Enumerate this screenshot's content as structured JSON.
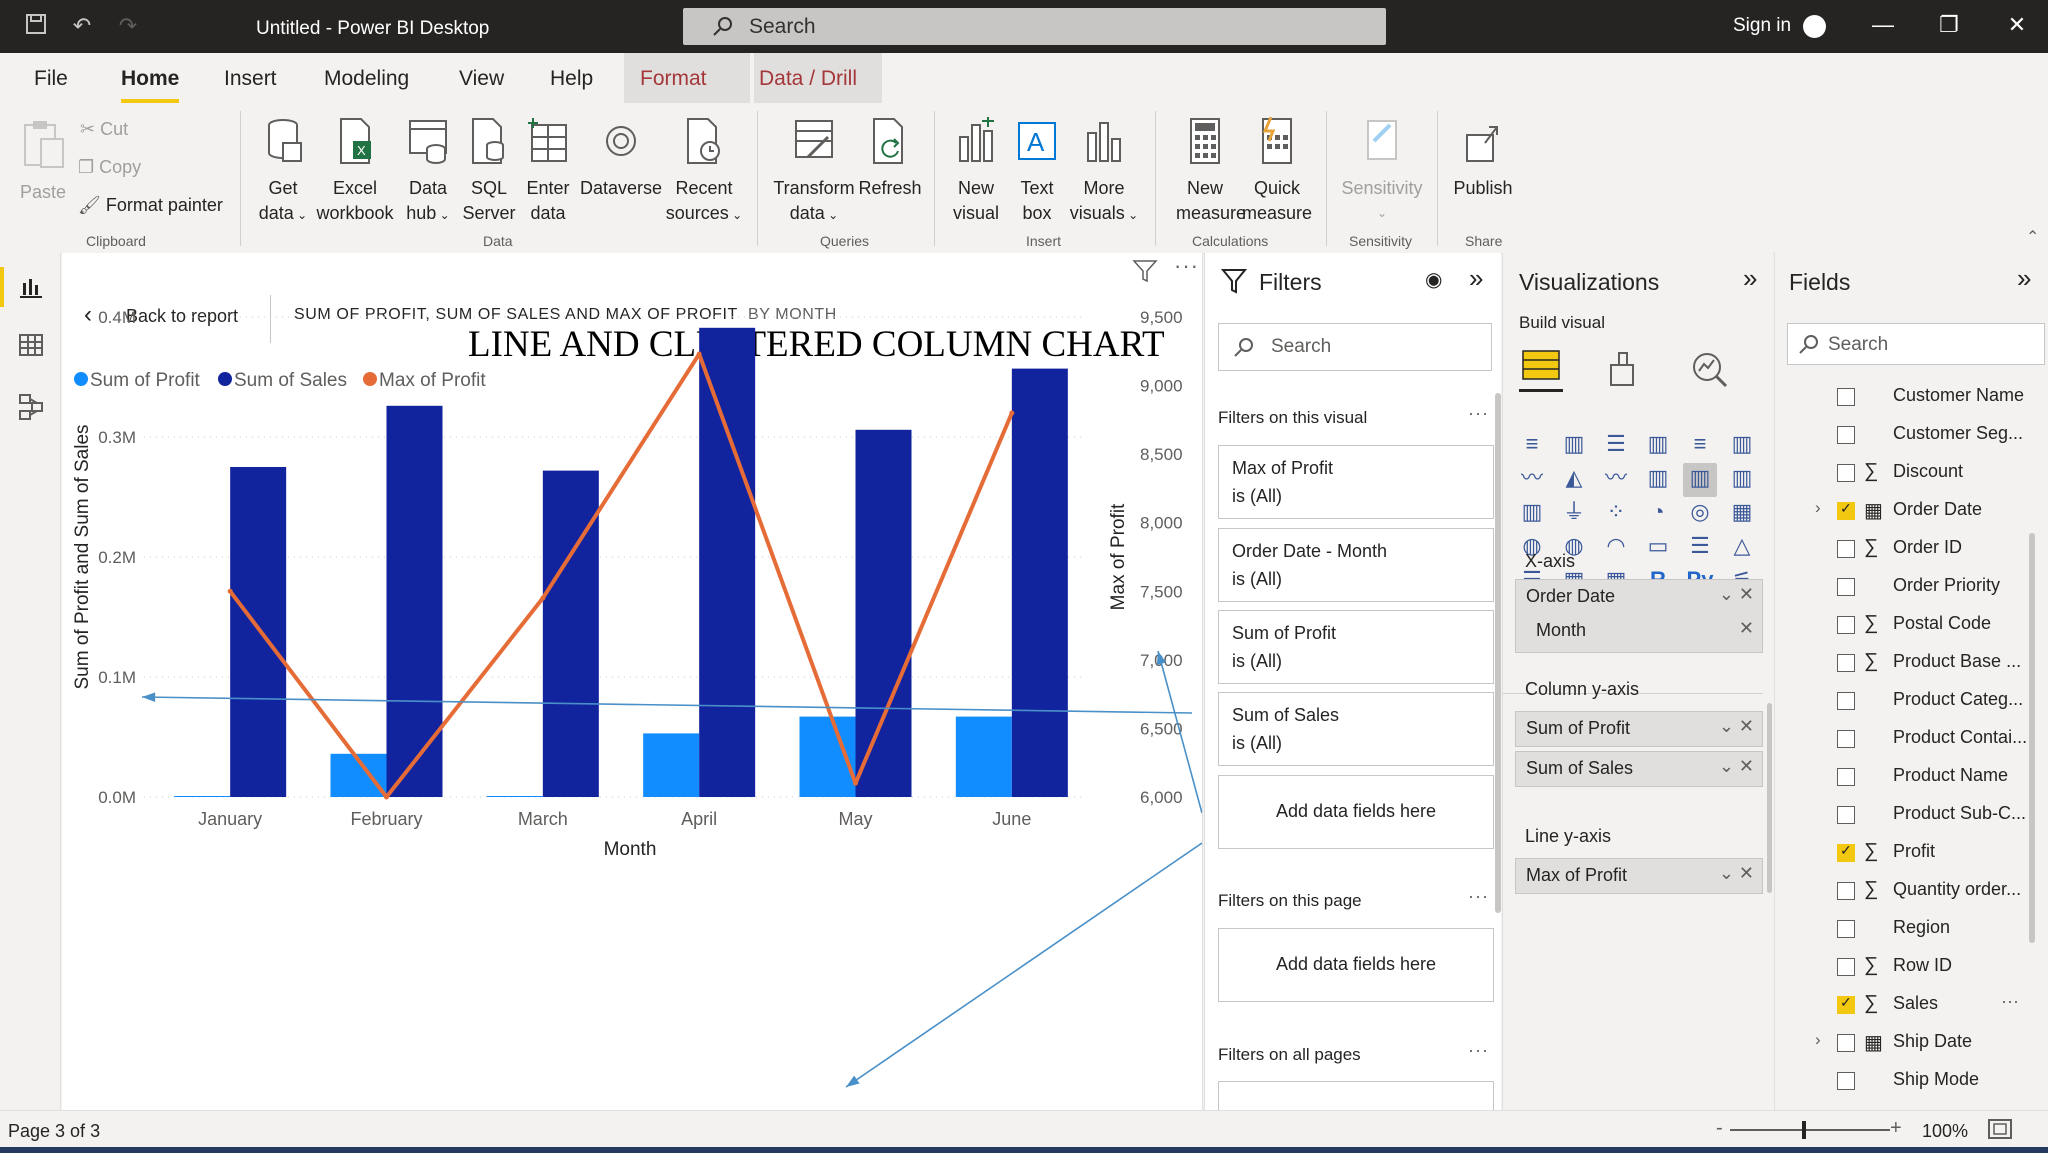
{
  "app": {
    "title": "Untitled - Power BI Desktop",
    "search_label": "Search",
    "sign_in": "Sign in"
  },
  "tabs": [
    "File",
    "Home",
    "Insert",
    "Modeling",
    "View",
    "Help",
    "Format",
    "Data / Drill"
  ],
  "ribbon": {
    "paste": "Paste",
    "cut": "Cut",
    "copy": "Copy",
    "format_painter": "Format painter",
    "clipboard": "Clipboard",
    "get_data": [
      "Get",
      "data"
    ],
    "excel": [
      "Excel",
      "workbook"
    ],
    "data_hub": [
      "Data",
      "hub"
    ],
    "sql": [
      "SQL",
      "Server"
    ],
    "enter_data": [
      "Enter",
      "data"
    ],
    "dataverse": "Dataverse",
    "recent": [
      "Recent",
      "sources"
    ],
    "data_group": "Data",
    "transform": [
      "Transform",
      "data"
    ],
    "refresh": "Refresh",
    "queries": "Queries",
    "new_visual": [
      "New",
      "visual"
    ],
    "text_box": [
      "Text",
      "box"
    ],
    "more_visuals": [
      "More",
      "visuals"
    ],
    "insert": "Insert",
    "new_measure": [
      "New",
      "measure"
    ],
    "quick_measure": [
      "Quick",
      "measure"
    ],
    "calculations": "Calculations",
    "sensitivity": "Sensitivity",
    "sensitivity_group": "Sensitivity",
    "publish": "Publish",
    "share": "Share"
  },
  "canvas": {
    "back": "Back to report",
    "header_title": "SUM OF PROFIT, SUM OF SALES AND MAX OF PROFIT",
    "header_by": "BY MONTH",
    "chart_caption": "LINE AND CLUSTERED COLUMN CHART"
  },
  "chart_data": {
    "type": "bar",
    "categories": [
      "January",
      "February",
      "March",
      "April",
      "May",
      "June"
    ],
    "xlabel": "Month",
    "ylabel": "Sum of Profit and Sum of Sales",
    "y2label": "Max of Profit",
    "legend_position": "top-left",
    "grid": true,
    "ylim": [
      0,
      400000
    ],
    "yticks": [
      "0.0M",
      "0.1M",
      "0.2M",
      "0.3M",
      "0.4M"
    ],
    "y2lim": [
      6000,
      9500
    ],
    "y2ticks": [
      "6,000",
      "6,500",
      "7,000",
      "7,500",
      "8,000",
      "8,500",
      "9,000",
      "9,500"
    ],
    "series": [
      {
        "name": "Sum of Profit",
        "kind": "column",
        "color": "#118dff",
        "values": [
          0,
          36000,
          0,
          53000,
          67000,
          67000
        ]
      },
      {
        "name": "Sum of Sales",
        "kind": "column",
        "color": "#12239e",
        "values": [
          275000,
          326000,
          272000,
          391000,
          306000,
          357000
        ]
      },
      {
        "name": "Max of Profit",
        "kind": "line",
        "axis": "secondary",
        "color": "#e66c37",
        "values": [
          7500,
          6000,
          7450,
          9230,
          6100,
          8800
        ]
      }
    ]
  },
  "filters": {
    "title": "Filters",
    "search": "Search",
    "on_visual": "Filters on this visual",
    "cards": [
      {
        "name": "Max of Profit",
        "state": "is (All)"
      },
      {
        "name": "Order Date - Month",
        "state": "is (All)"
      },
      {
        "name": "Sum of Profit",
        "state": "is (All)"
      },
      {
        "name": "Sum of Sales",
        "state": "is (All)"
      }
    ],
    "add_here": "Add data fields here",
    "on_page": "Filters on this page",
    "add_here_page": "Add data fields here",
    "on_all": "Filters on all pages"
  },
  "viz": {
    "title": "Visualizations",
    "build": "Build visual",
    "x_axis": "X-axis",
    "x_field": "Order Date",
    "x_sub": "Month",
    "col_axis": "Column y-axis",
    "col_fields": [
      "Sum of Profit",
      "Sum of Sales"
    ],
    "line_axis": "Line y-axis",
    "line_field": "Max of Profit"
  },
  "fields": {
    "title": "Fields",
    "search": "Search",
    "items": [
      {
        "name": "Customer Name",
        "sigma": false,
        "checked": false
      },
      {
        "name": "Customer Seg...",
        "sigma": false,
        "checked": false
      },
      {
        "name": "Discount",
        "sigma": true,
        "checked": false
      },
      {
        "name": "Order Date",
        "sigma": false,
        "checked": true
      },
      {
        "name": "Order ID",
        "sigma": true,
        "checked": false
      },
      {
        "name": "Order Priority",
        "sigma": false,
        "checked": false
      },
      {
        "name": "Postal Code",
        "sigma": true,
        "checked": false
      },
      {
        "name": "Product Base ...",
        "sigma": true,
        "checked": false
      },
      {
        "name": "Product Categ...",
        "sigma": false,
        "checked": false
      },
      {
        "name": "Product Contai...",
        "sigma": false,
        "checked": false
      },
      {
        "name": "Product Name",
        "sigma": false,
        "checked": false
      },
      {
        "name": "Product Sub-C...",
        "sigma": false,
        "checked": false
      },
      {
        "name": "Profit",
        "sigma": true,
        "checked": true
      },
      {
        "name": "Quantity order...",
        "sigma": true,
        "checked": false
      },
      {
        "name": "Region",
        "sigma": false,
        "checked": false
      },
      {
        "name": "Row ID",
        "sigma": true,
        "checked": false
      },
      {
        "name": "Sales",
        "sigma": true,
        "checked": true
      },
      {
        "name": "Ship Date",
        "sigma": false,
        "checked": false
      },
      {
        "name": "Ship Mode",
        "sigma": false,
        "checked": false
      }
    ]
  },
  "status": {
    "page": "Page 3 of 3",
    "zoom": "100%"
  }
}
